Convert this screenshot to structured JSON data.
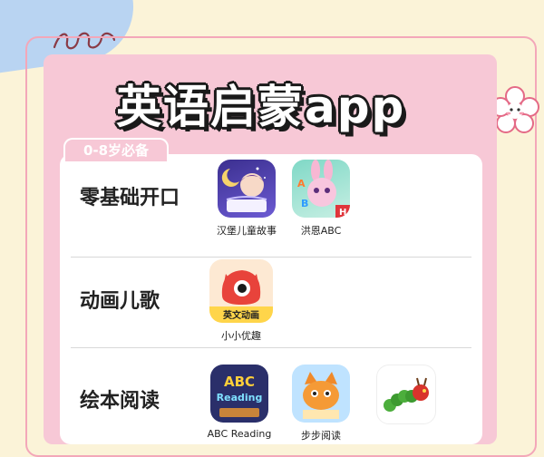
{
  "title": "英语启蒙app",
  "badge": "0-8岁必备",
  "categories": [
    {
      "label": "零基础开口",
      "apps": [
        {
          "name": "汉堡儿童故事",
          "icon": "moon-girl-icon"
        },
        {
          "name": "洪恩ABC",
          "icon": "bunny-abc-icon"
        }
      ]
    },
    {
      "label": "动画儿歌",
      "apps": [
        {
          "name": "小小优趣",
          "icon": "red-monster-icon",
          "icon_caption": "英文动画"
        }
      ]
    },
    {
      "label": "绘本阅读",
      "apps": [
        {
          "name": "ABC Reading",
          "icon": "abc-reading-icon",
          "icon_text": "ABC Reading"
        },
        {
          "name": "步步阅读",
          "icon": "orange-cat-icon"
        },
        {
          "name": "",
          "icon": "caterpillar-icon"
        }
      ]
    }
  ],
  "colors": {
    "panel": "#f7c8d6",
    "background": "#fbf3d8",
    "frame": "#f3a7b9"
  }
}
